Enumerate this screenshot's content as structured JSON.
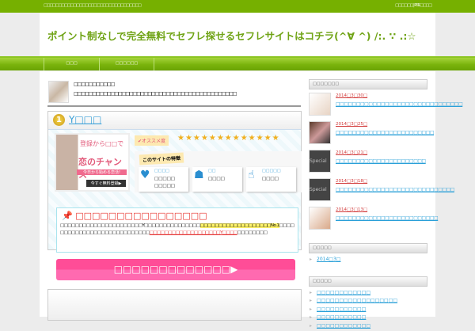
{
  "topbar": {
    "description": "□□□□□□□□□□□□□□□□□□□□□□□□□□□□□□□□□",
    "links": "□□□□□□ | RSS□□□□"
  },
  "header": {
    "title": "ポイント制なしで完全無料でセフレ探せるセフレサイトはコチラ(^∀ ^) /:. ∵ .:☆"
  },
  "nav": [
    {
      "label": "□□□"
    },
    {
      "label": "□□□□□□"
    }
  ],
  "author": {
    "name": "□□□□□□□□□□□",
    "bio": "□□□□□□□□□□□□□□□□□□□□□□□□□□□□□□□□□□□□□□□□□□□□"
  },
  "rank1": {
    "number": "1",
    "name": "Y□□□",
    "banner": {
      "line1": "登録から□□で",
      "line2": "恋のチャンス",
      "line3": "今日から始める恋活!",
      "button": "今すぐ無料登録▶"
    },
    "recommend_label": "✔オススメ度",
    "stars": "★★★★★★★★★★★★★",
    "stars_count": 13,
    "features_label": "このサイトの特徴",
    "features": [
      {
        "icon": "heart-chat-icon",
        "heading": "□□□□",
        "value": "□□□□□ □□□□□"
      },
      {
        "icon": "woman-icon",
        "heading": "□□",
        "value": "□□□□"
      },
      {
        "icon": "finger-tap-icon",
        "heading": "□□□□□",
        "value": "□□□□"
      }
    ],
    "point_heading": "□□□□□□□□□□□□□□□□",
    "point_text_1": "□□□□□□□□□□□□□□□□□□□□□□Y□□□□□□□□□□□□□□□",
    "point_highlight": "□□□□□□□□□□□□□□□□□□□No.1",
    "point_text_2": "□□□□□□□□□□□□□□□□□□□□□□□□□□□□",
    "point_red": "□□□□□□□□□□□□□□□□□□□Y□□□□",
    "point_text_3": "□□□□□□□□",
    "cta": "□□□□□□□□□□□□□▶"
  },
  "sidebar": {
    "recent_title": "□□□□□□□",
    "posts": [
      {
        "date": "2014□3□30□",
        "title": "□□□□□□□□□□□□□□□□□□□□□□□□□□□□□□□"
      },
      {
        "date": "2014□3□25□",
        "title": "□□□□□□□□□□□□□□□□□□□□□□□□"
      },
      {
        "date": "2014□3□21□",
        "title": "□□□□□□□□□□□□□□□□□□□□□□"
      },
      {
        "date": "2014□3□18□",
        "title": "□□□□□□□□□□□□□□□□□□□□□□□□□□□□□"
      },
      {
        "date": "2014□3□13□",
        "title": "□□□□□□□□□□□□□□□□□□□□□□□□□"
      }
    ],
    "archive_title": "□□□□□",
    "archives": [
      "2014□3□"
    ],
    "category_title": "□□□□□",
    "categories": [
      "□□□□□□□□□□□□",
      "□□□□□□□□□□□□□□□□□□",
      "□□□□□□□□□□□",
      "□□□□□□□□□□□",
      "□□□□□□□□□□□□"
    ]
  }
}
